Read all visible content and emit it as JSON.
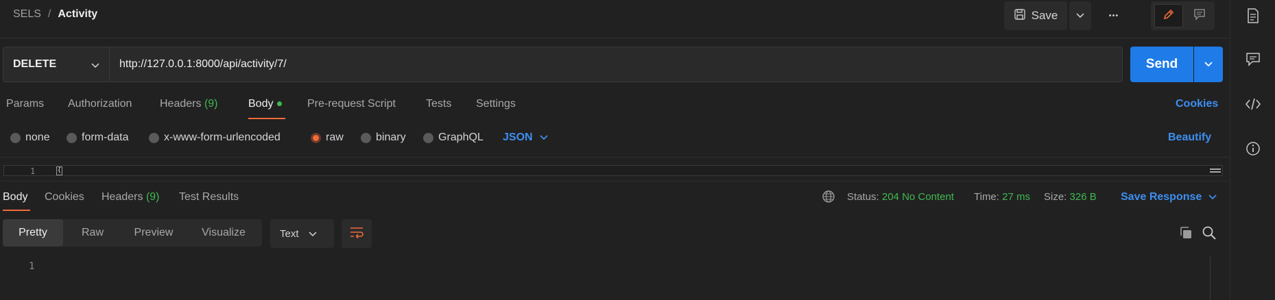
{
  "header": {
    "workspace": "SELS",
    "separator": "/",
    "request_name": "Activity",
    "save_label": "Save",
    "more_label": "•••"
  },
  "request": {
    "method": "DELETE",
    "url": "http://127.0.0.1:8000/api/activity/7/",
    "send_label": "Send"
  },
  "request_tabs": {
    "params": "Params",
    "authorization": "Authorization",
    "headers": "Headers",
    "headers_count": "(9)",
    "body": "Body",
    "prerequest": "Pre-request Script",
    "tests": "Tests",
    "settings": "Settings",
    "cookies": "Cookies"
  },
  "body_types": {
    "none": "none",
    "form_data": "form-data",
    "urlencoded": "x-www-form-urlencoded",
    "raw": "raw",
    "binary": "binary",
    "graphql": "GraphQL",
    "selected": "raw",
    "format": "JSON",
    "beautify": "Beautify"
  },
  "editor": {
    "line_number": "1",
    "content": "{"
  },
  "response": {
    "tabs": {
      "body": "Body",
      "cookies": "Cookies",
      "headers": "Headers",
      "headers_count": "(9)",
      "test_results": "Test Results"
    },
    "status_label": "Status:",
    "status_value": "204 No Content",
    "time_label": "Time:",
    "time_value": "27 ms",
    "size_label": "Size:",
    "size_value": "326 B",
    "save_response": "Save Response",
    "views": {
      "pretty": "Pretty",
      "raw": "Raw",
      "preview": "Preview",
      "visualize": "Visualize"
    },
    "format": "Text",
    "line_number": "1"
  },
  "colors": {
    "accent_orange": "#f26b3a",
    "accent_blue": "#1e7be8",
    "link_blue": "#3d8ff2",
    "status_green": "#3fb950",
    "background": "#212121"
  },
  "icons": {
    "right_sidebar": [
      "document-icon",
      "comments-icon",
      "code-icon",
      "info-icon"
    ]
  }
}
